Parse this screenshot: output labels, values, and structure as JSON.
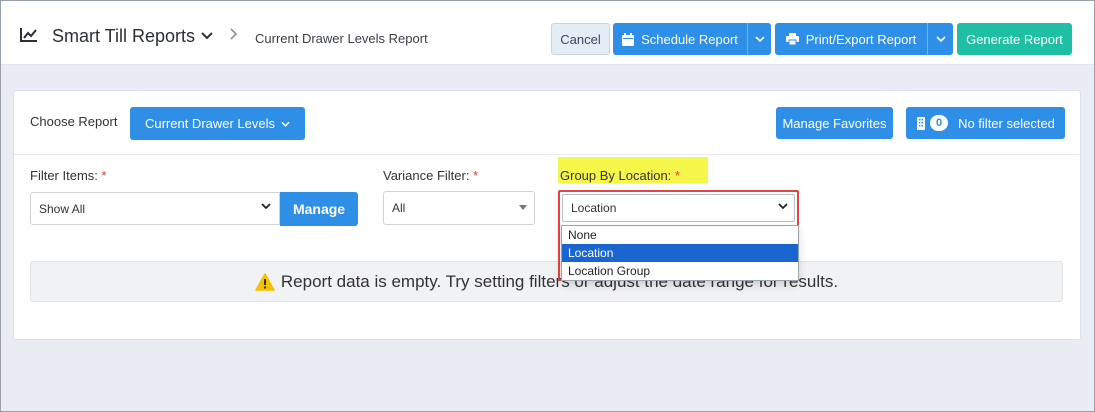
{
  "header": {
    "app_title": "Smart Till Reports",
    "app_icon": "line-chart-icon",
    "breadcrumb": "Current Drawer Levels Report",
    "buttons": {
      "cancel": "Cancel",
      "schedule": "Schedule Report",
      "print_export": "Print/Export Report",
      "generate": "Generate Report"
    }
  },
  "report_bar": {
    "choose_label": "Choose Report",
    "selected_report": "Current Drawer Levels",
    "manage_favorites": "Manage Favorites",
    "filter_count": "0",
    "filter_status": "No filter selected"
  },
  "filters": {
    "filter_items": {
      "label": "Filter Items:",
      "required_mark": "*",
      "value": "Show All",
      "manage_button": "Manage"
    },
    "variance": {
      "label": "Variance Filter:",
      "required_mark": "*",
      "value": "All"
    },
    "group_by": {
      "label": "Group By Location:",
      "required_mark": "*",
      "value": "Location",
      "options": [
        "None",
        "Location",
        "Location Group"
      ],
      "selected_index": 1
    }
  },
  "empty_message": "Report data is empty. Try setting filters or adjust the date range for results.",
  "colors": {
    "primary": "#2f8fe6",
    "success": "#1fbfa3",
    "highlight": "#f4f74a",
    "outline_red": "#e04545",
    "dropdown_selected": "#1a66d1"
  }
}
